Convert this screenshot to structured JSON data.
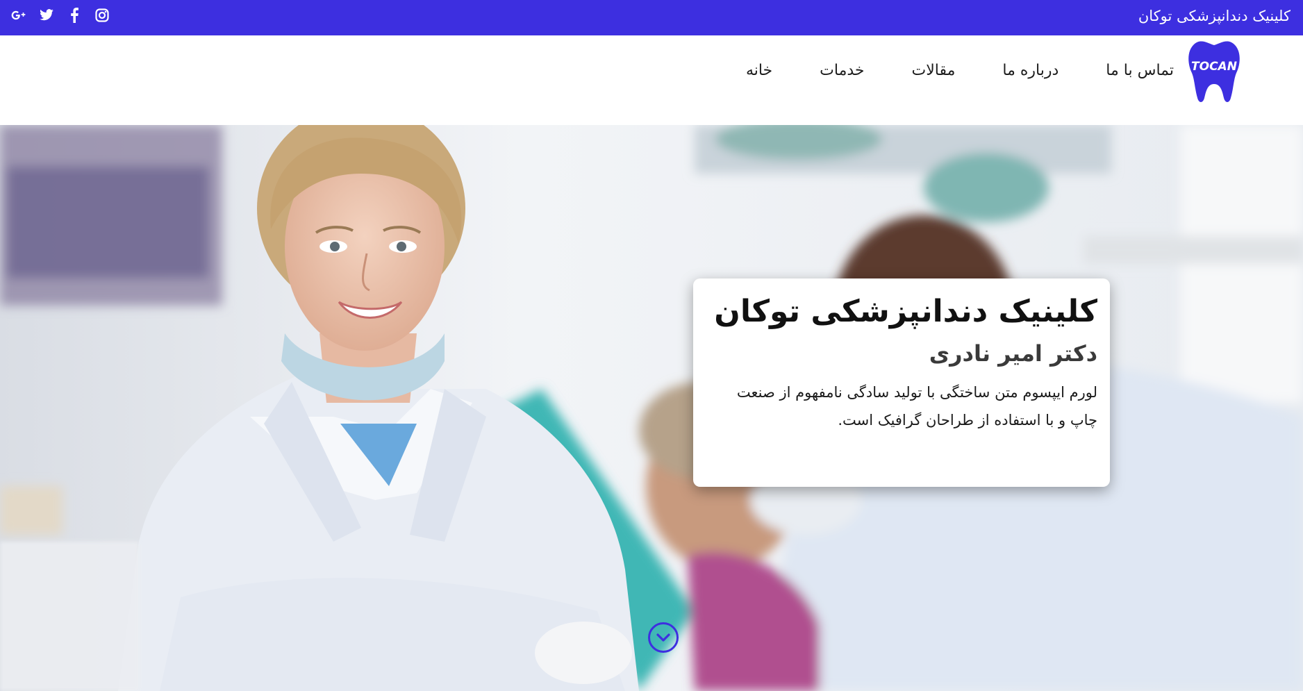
{
  "topbar": {
    "site_name": "کلینیک دندانپزشکی توکان",
    "social_icons": [
      "instagram-icon",
      "facebook-icon",
      "twitter-icon",
      "google-plus-icon"
    ]
  },
  "header": {
    "logo_text": "TOCAN",
    "nav": [
      {
        "label": "خانه"
      },
      {
        "label": "خدمات"
      },
      {
        "label": "مقالات"
      },
      {
        "label": "درباره ما"
      },
      {
        "label": "تماس با ما"
      }
    ]
  },
  "hero": {
    "title": "کلینیک دندانپزشکی توکان",
    "subtitle": "دکتر امیر نادری",
    "description": "لورم ایپسوم متن ساختگی با تولید سادگی نامفهوم از صنعت چاپ و با استفاده از طراحان گرافیک است.",
    "scroll_icon": "chevron-down-icon"
  },
  "colors": {
    "accent": "#3d2fe0",
    "text": "#1d1d1d"
  }
}
